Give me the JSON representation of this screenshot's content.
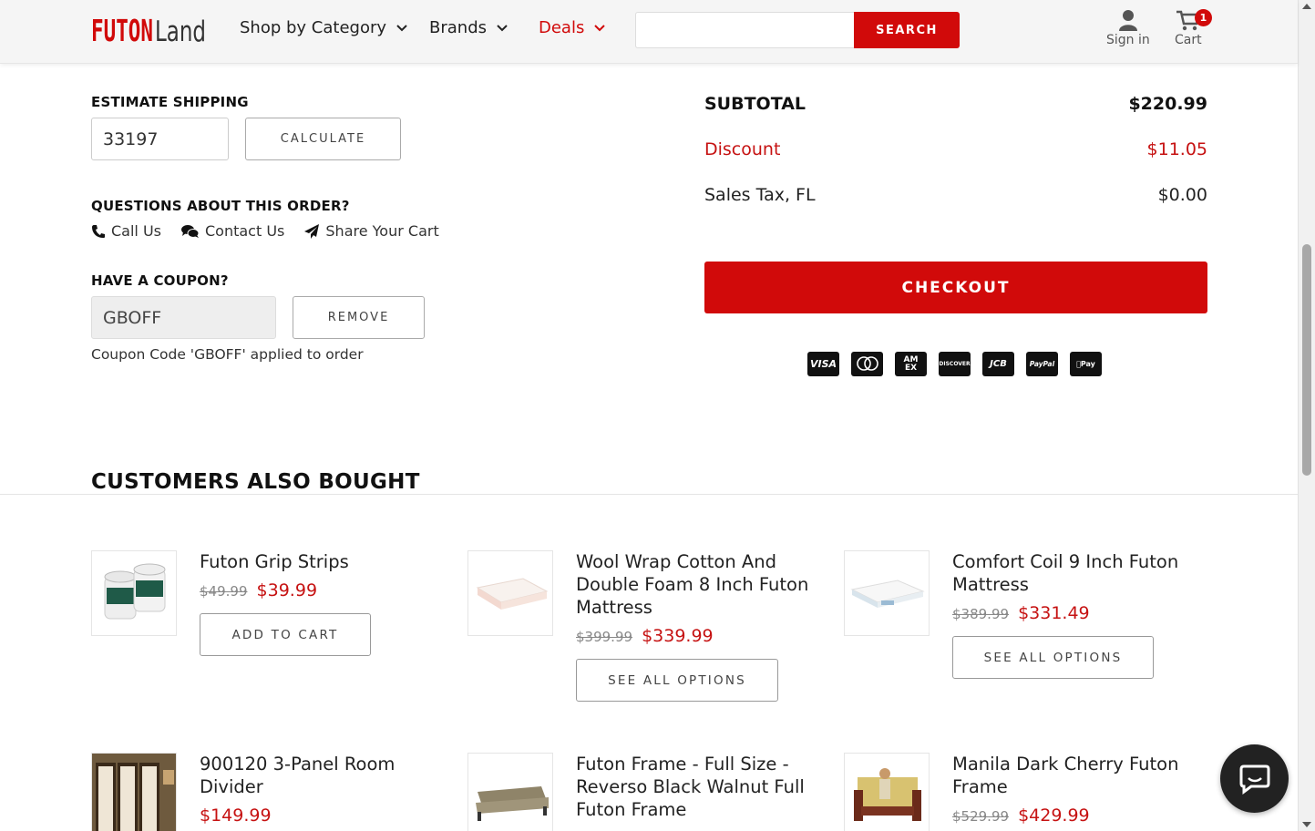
{
  "header": {
    "logo_text": "FUTONLAND",
    "nav": [
      {
        "label": "Shop by Category"
      },
      {
        "label": "Brands"
      },
      {
        "label": "Deals"
      }
    ],
    "search": {
      "value": "",
      "placeholder": "",
      "button_label": "SEARCH"
    },
    "sign_in_label": "Sign in",
    "cart_label": "Cart",
    "cart_count": "1",
    "accent_color": "#d10a0a"
  },
  "shipping": {
    "title": "ESTIMATE SHIPPING",
    "zip_value": "33197",
    "calculate_label": "CALCULATE"
  },
  "questions": {
    "title": "QUESTIONS ABOUT THIS ORDER?",
    "links": [
      "Call Us",
      "Contact Us",
      "Share Your Cart"
    ]
  },
  "coupon": {
    "title": "HAVE A COUPON?",
    "value": "GBOFF",
    "remove_label": "REMOVE",
    "note": "Coupon Code 'GBOFF' applied to order"
  },
  "totals": {
    "subtotal_label": "SUBTOTAL",
    "subtotal_value": "$220.99",
    "discount_label": "Discount",
    "discount_value": "$11.05",
    "tax_label": "Sales Tax, FL",
    "tax_value": "$0.00",
    "checkout_label": "CHECKOUT",
    "payment_methods": [
      "VISA",
      "mastercard",
      "AMEX",
      "DISCOVER",
      "JCB",
      "PayPal",
      "Apple Pay"
    ]
  },
  "also_bought": {
    "title": "CUSTOMERS ALSO BOUGHT",
    "products": [
      {
        "name": "Futon Grip Strips",
        "old_price": "$49.99",
        "price": "$39.99",
        "button": "ADD TO CART"
      },
      {
        "name": "Wool Wrap Cotton And Double Foam 8 Inch Futon Mattress",
        "old_price": "$399.99",
        "price": "$339.99",
        "button": "SEE ALL OPTIONS"
      },
      {
        "name": "Comfort Coil 9 Inch Futon Mattress",
        "old_price": "$389.99",
        "price": "$331.49",
        "button": "SEE ALL OPTIONS"
      },
      {
        "name": "900120 3-Panel Room Divider",
        "old_price": "",
        "price": "$149.99",
        "button": ""
      },
      {
        "name": "Futon Frame - Full Size - Reverso Black Walnut Full Futon Frame",
        "old_price": "",
        "price": "",
        "button": ""
      },
      {
        "name": "Manila Dark Cherry Futon Frame",
        "old_price": "$529.99",
        "price": "$429.99",
        "button": ""
      }
    ]
  }
}
